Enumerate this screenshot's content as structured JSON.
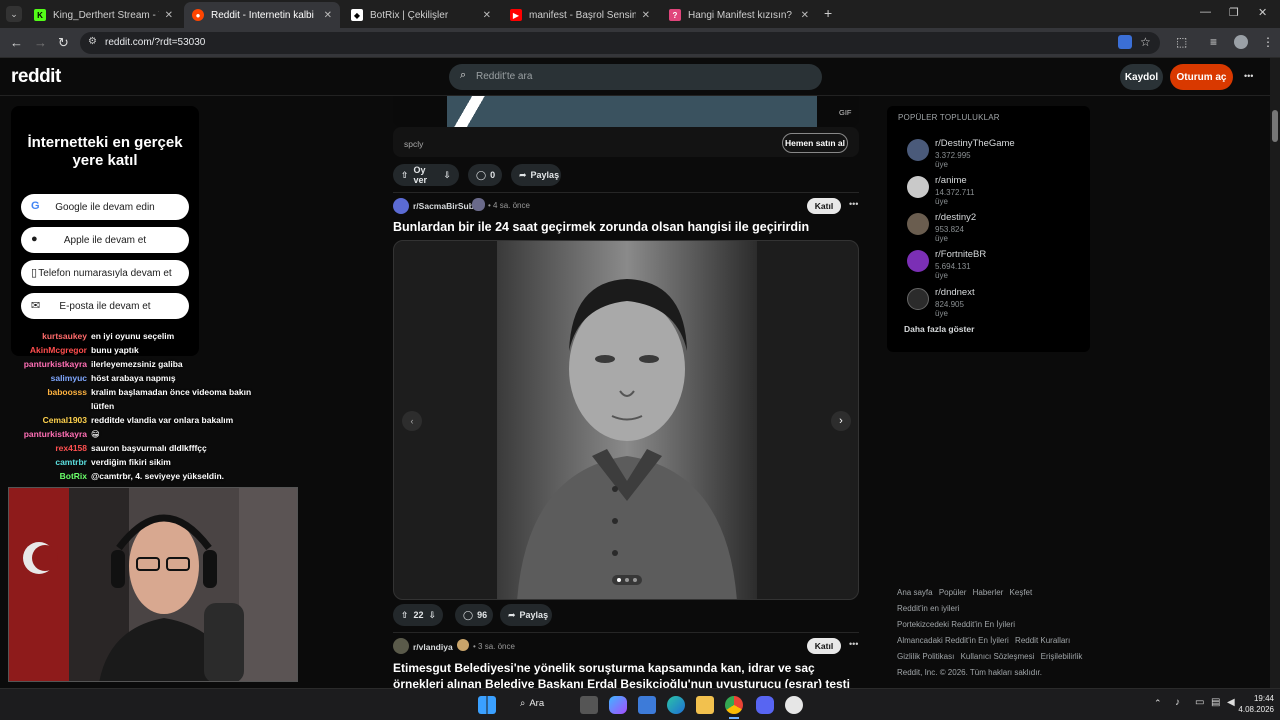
{
  "browser": {
    "tabs": [
      {
        "label": "King_Derthert Stream - Watch L",
        "active": false
      },
      {
        "label": "Reddit - İnternetin kalbi",
        "active": true
      },
      {
        "label": "BotRix | Çekilişler",
        "active": false
      },
      {
        "label": "manifest - Başrol Sensin | Offici",
        "active": false
      },
      {
        "label": "Hangi Manifest kızısın? 🎤 - Te",
        "active": false
      }
    ],
    "url": "reddit.com/?rdt=53030"
  },
  "header": {
    "logo": "reddit",
    "search_placeholder": "Reddit'te ara",
    "signup_label": "Kaydol",
    "login_label": "Oturum aç",
    "more_label": "•••"
  },
  "login_card": {
    "title": "İnternetteki en gerçek yere katıl",
    "buttons": [
      "Google ile devam edin",
      "Apple ile devam et",
      "Telefon numarasıyla devam et",
      "E-posta ile devam et"
    ]
  },
  "chat": [
    {
      "user": "kurtsaukey",
      "msg": "en iyi oyunu seçelim",
      "color": "#ff6b6b"
    },
    {
      "user": "AkinMcgregor",
      "msg": "bunu yaptık",
      "color": "#ff4d4d"
    },
    {
      "user": "panturkistkayra",
      "msg": "ilerleyemezsiniz galiba",
      "color": "#ff6fb5"
    },
    {
      "user": "salimyuc",
      "msg": "höst arabaya napmış",
      "color": "#7fa7ff"
    },
    {
      "user": "baboosss",
      "msg": "kralim başlamadan önce videoma bakın",
      "msg2": "lütfen",
      "color": "#ffb340"
    },
    {
      "user": "Cemal1903",
      "msg": "redditde vlandia var onlara bakalım",
      "color": "#ffd24d"
    },
    {
      "user": "panturkistkayra",
      "msg": "😁",
      "color": "#ff6fb5"
    },
    {
      "user": "rex4158",
      "msg": "sauron başvurmalı dldlkfffçç",
      "color": "#ff5050"
    },
    {
      "user": "camtrbr",
      "msg": "verdiğim fikiri sikim",
      "color": "#5ce0e0"
    },
    {
      "user": "BotRix",
      "msg": "@camtrbr, 4. seviyeye yükseldin.",
      "color": "#6bff6b"
    }
  ],
  "feed": {
    "ad": {
      "source": "spcly",
      "gif": "GIF",
      "cta": "Hemen satın al",
      "vote": "Oy ver",
      "comments": "0",
      "share": "Paylaş"
    },
    "post1": {
      "subreddit": "r/SacmaBirSub",
      "time": "• 4 sa. önce",
      "join": "Katıl",
      "title": "Bunlardan bir ile 24 saat geçirmek zorunda olsan hangisi ile geçirirdin",
      "votes": "22",
      "comments": "96",
      "share": "Paylaş"
    },
    "post2": {
      "subreddit": "r/vlandiya",
      "time": "• 3 sa. önce",
      "join": "Katıl",
      "title": "Etimesgut Belediyesi'ne yönelik soruşturma kapsamında kan, idrar ve saç örnekleri alınan Belediye Başkanı Erdal Beşikçioğlu'nun uyuşturucu (esrar) testi pozitif çıktı."
    }
  },
  "communities": {
    "heading": "POPÜLER TOPLULUKLAR",
    "items": [
      {
        "name": "r/DestinyTheGame",
        "members": "3.372.995 üye",
        "color": "#4a5a7a"
      },
      {
        "name": "r/anime",
        "members": "14.372.711 üye",
        "color": "#c9c9c9"
      },
      {
        "name": "r/destiny2",
        "members": "953.824 üye",
        "color": "#6a5d4f"
      },
      {
        "name": "r/FortniteBR",
        "members": "5.694.131 üye",
        "color": "#7b2fb5"
      },
      {
        "name": "r/dndnext",
        "members": "824.905 üye",
        "color": "#2b2b2b"
      }
    ],
    "more": "Daha fazla göster"
  },
  "footer": {
    "line1": [
      "Ana sayfa",
      "Popüler",
      "Haberler",
      "Keşfet"
    ],
    "line2": "Reddit'in en iyileri",
    "line3": "Portekizcedeki Reddit'in En İyileri",
    "line4": [
      "Almancadaki Reddit'in En İyileri",
      "Reddit Kuralları"
    ],
    "line5": [
      "Gizlilik Politikası",
      "Kullanıcı Sözleşmesi",
      "Erişilebilirlik"
    ],
    "line6": "Reddit, Inc. © 2026. Tüm hakları saklıdır."
  },
  "taskbar": {
    "search": "Ara",
    "time": "19:44",
    "date": "4.08.2026"
  }
}
